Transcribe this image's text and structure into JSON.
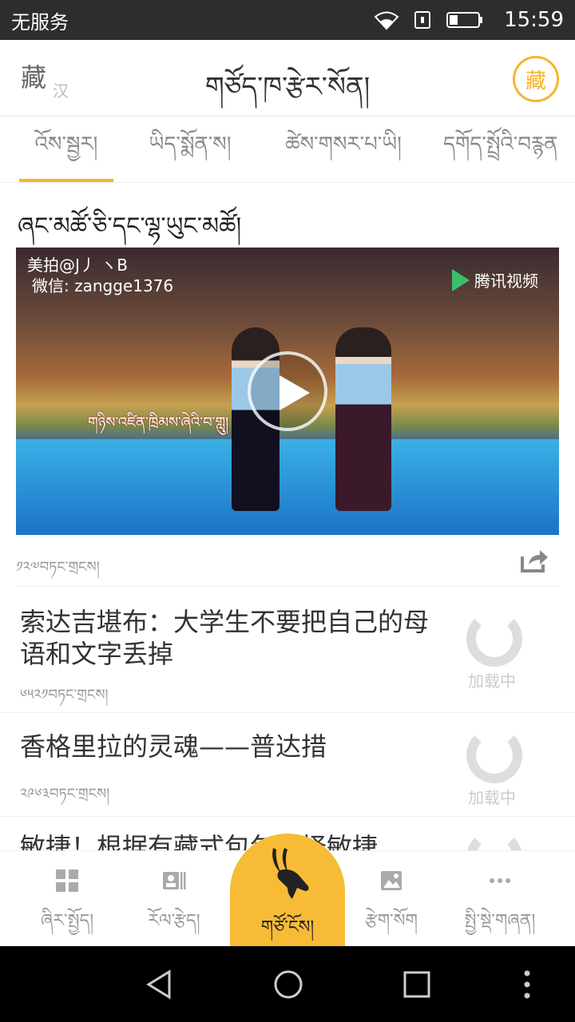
{
  "status_bar": {
    "carrier": "无服务",
    "time": "15:59"
  },
  "app_bar": {
    "lang_primary": "藏",
    "lang_secondary": "汉",
    "title": "གཙོད་ཁ་རྩེར་སོན།",
    "logo_char": "藏"
  },
  "tabs": [
    {
      "label": "འོས་སྦྱར།"
    },
    {
      "label": "ཡིད་སྨོན་ས།"
    },
    {
      "label": "ཚེས་གསར་པ་ཡི།"
    },
    {
      "label": "དགོད་སྤྲོའི་བརྙན"
    }
  ],
  "section_title": "ཞང་མཚོ་ཅི་དང་ལྷ་ཡུང་མཚོ།",
  "video": {
    "watermark_line1": "美拍@J丿 ヽB",
    "watermark_line2": "微信: zangge1376",
    "brand": "腾讯视频",
    "caption": "གཉིས་འཛིན་ཁྲིམས་ཞེའི་བ་གླུ།",
    "views": "༡༢༧བཏང་གྲངས།"
  },
  "news": [
    {
      "title": "索达吉堪布：大学生不要把自己的母语和文字丢掉",
      "views": "༦༥༢༡བཏང་གྲངས།",
      "loading": "加载中"
    },
    {
      "title": "香格里拉的灵魂——普达措",
      "views": "༢༩༦༣བཏང་གྲངས།",
      "loading": "加载中"
    },
    {
      "title": "敏捷！根据有藏式包包选择敏捷",
      "views": "",
      "loading": ""
    }
  ],
  "bottom_nav": [
    {
      "label": "ཞིར་སྤྱོད།",
      "icon": "grid-icon"
    },
    {
      "label": "རོལ་རྩེད།",
      "icon": "card-icon"
    },
    {
      "label": "གཙོ་ངོས།",
      "icon": "antelope-icon"
    },
    {
      "label": "རྩེག་སོག",
      "icon": "image-icon"
    },
    {
      "label": "སྤྱི་སྡེ་གཞན།",
      "icon": "more-icon"
    }
  ],
  "colors": {
    "accent": "#f5b52c",
    "nav_center": "#f8bb36"
  }
}
